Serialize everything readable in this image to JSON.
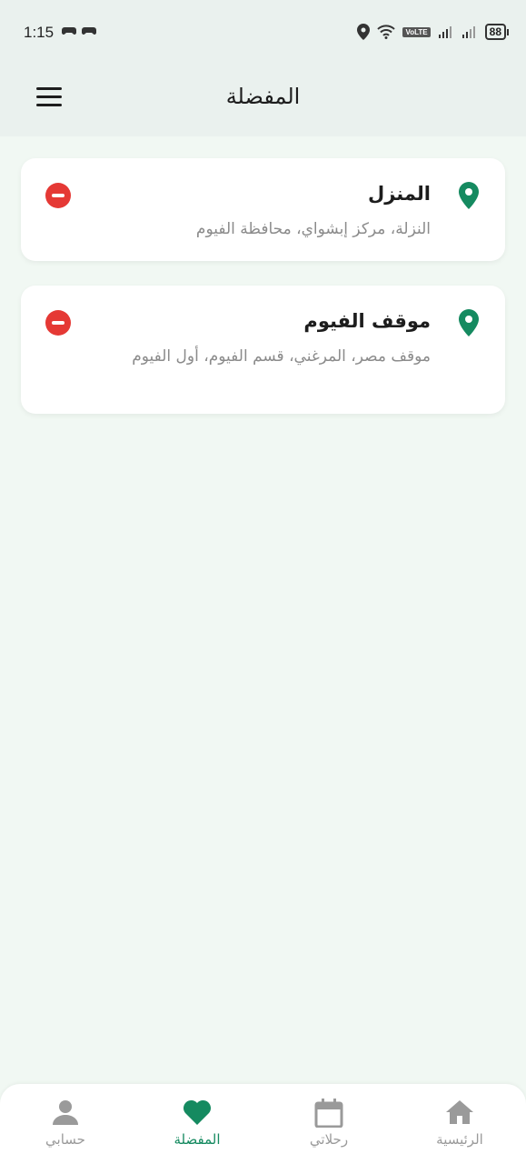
{
  "status_bar": {
    "time": "1:15",
    "volte": "VoLTE",
    "battery": "88"
  },
  "header": {
    "title": "المفضلة"
  },
  "favorites": [
    {
      "name": "المنزل",
      "address": "النزلة، مركز إبشواي، محافظة الفيوم"
    },
    {
      "name": "موقف الفيوم",
      "address": "موقف مصر، المرغني، قسم الفيوم، أول الفيوم"
    }
  ],
  "bottom_nav": {
    "items": [
      {
        "label": "حسابي",
        "icon": "person-icon"
      },
      {
        "label": "المفضلة",
        "icon": "heart-icon",
        "active": true
      },
      {
        "label": "رحلاتي",
        "icon": "calendar-icon"
      },
      {
        "label": "الرئيسية",
        "icon": "home-icon"
      }
    ]
  },
  "colors": {
    "accent": "#158a60",
    "remove": "#e53935",
    "background": "#f1f8f3"
  }
}
